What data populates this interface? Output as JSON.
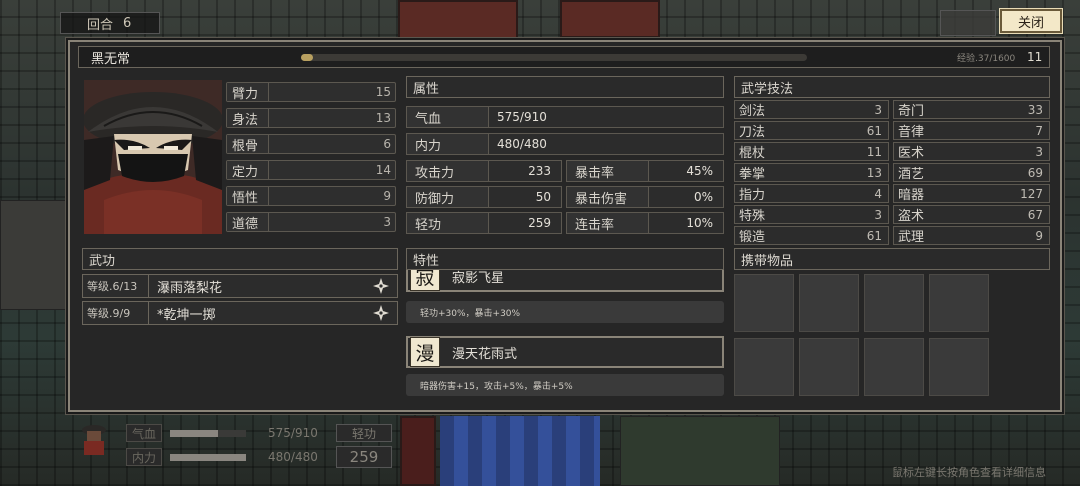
{
  "hud_top": {
    "round_label": "回合",
    "round_value": "6"
  },
  "close_label": "关闭",
  "character": {
    "name": "黑无常",
    "exp_text": "经验.37/1600",
    "exp_fraction": 0.023,
    "level": "11"
  },
  "base_stats": [
    {
      "label": "臂力",
      "value": "15"
    },
    {
      "label": "身法",
      "value": "13"
    },
    {
      "label": "根骨",
      "value": "6"
    },
    {
      "label": "定力",
      "value": "14"
    },
    {
      "label": "悟性",
      "value": "9"
    },
    {
      "label": "道德",
      "value": "3"
    }
  ],
  "attributes": {
    "header": "属性",
    "hp": {
      "label": "气血",
      "value": "575/910"
    },
    "mp": {
      "label": "内力",
      "value": "480/480"
    },
    "pairs": [
      {
        "l_label": "攻击力",
        "l_value": "233",
        "r_label": "暴击率",
        "r_value": "45%"
      },
      {
        "l_label": "防御力",
        "l_value": "50",
        "r_label": "暴击伤害",
        "r_value": "0%"
      },
      {
        "l_label": "轻功",
        "l_value": "259",
        "r_label": "连击率",
        "r_value": "10%"
      }
    ]
  },
  "skills": {
    "header": "武学技法",
    "left": [
      {
        "name": "剑法",
        "value": "3"
      },
      {
        "name": "刀法",
        "value": "61"
      },
      {
        "name": "棍杖",
        "value": "11"
      },
      {
        "name": "拳掌",
        "value": "13"
      },
      {
        "name": "指力",
        "value": "4"
      },
      {
        "name": "特殊",
        "value": "3"
      },
      {
        "name": "锻造",
        "value": "61"
      }
    ],
    "right": [
      {
        "name": "奇门",
        "value": "33"
      },
      {
        "name": "音律",
        "value": "7"
      },
      {
        "name": "医术",
        "value": "3"
      },
      {
        "name": "酒艺",
        "value": "69"
      },
      {
        "name": "暗器",
        "value": "127"
      },
      {
        "name": "盗术",
        "value": "67"
      },
      {
        "name": "武理",
        "value": "9"
      }
    ]
  },
  "martial": {
    "header": "武功",
    "items": [
      {
        "level": "等级.6/13",
        "name": "瀑雨落梨花"
      },
      {
        "level": "等级.9/9",
        "name": "*乾坤一掷"
      }
    ]
  },
  "traits": {
    "header": "特性",
    "items": [
      {
        "glyph": "寂",
        "name": "寂影飞星",
        "desc": "轻功+30%，暴击+30%"
      },
      {
        "glyph": "漫",
        "name": "漫天花雨式",
        "desc": "暗器伤害+15，攻击+5%，暴击+5%"
      }
    ]
  },
  "inventory": {
    "header": "携带物品",
    "slots": 8
  },
  "bottom_hud": {
    "hp_label": "气血",
    "hp_value": "575/910",
    "hp_fraction": 0.63,
    "mp_label": "内力",
    "mp_value": "480/480",
    "mp_fraction": 1.0,
    "qinggong_label": "轻功",
    "qinggong_value": "259",
    "hint": "鼠标左键长按角色查看详细信息"
  }
}
